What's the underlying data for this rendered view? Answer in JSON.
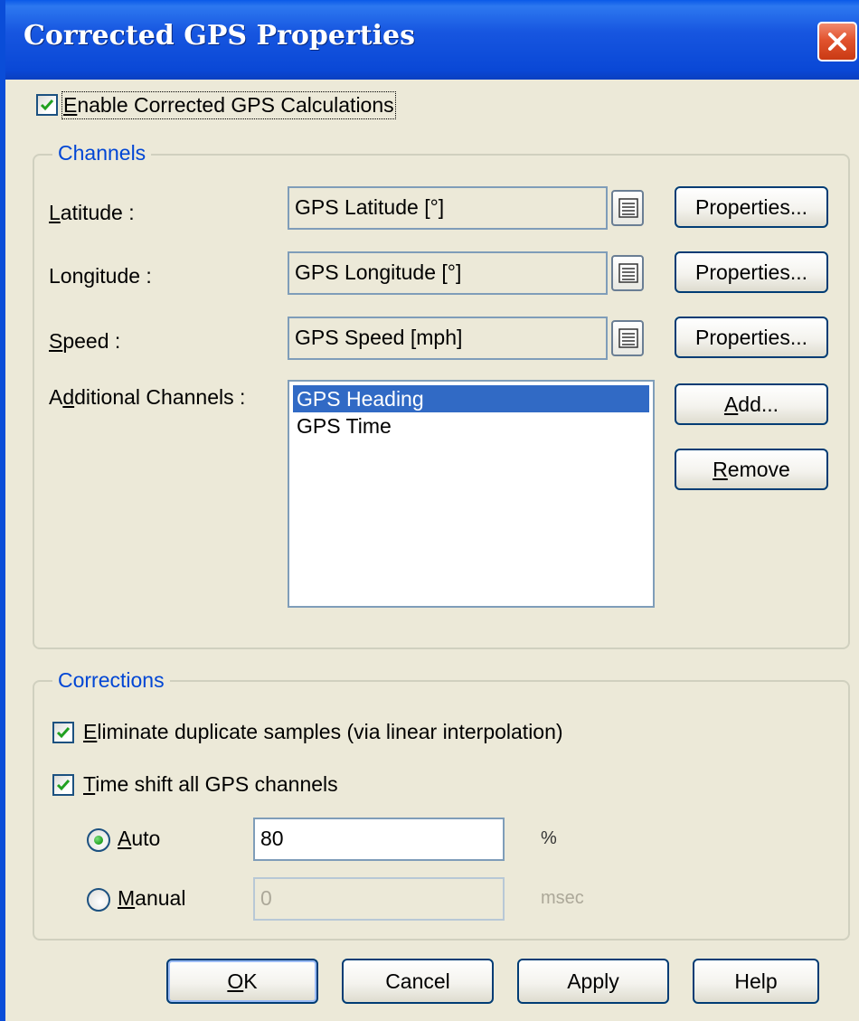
{
  "window": {
    "title": "Corrected GPS Properties"
  },
  "enable_checkbox": {
    "label_u": "E",
    "label_rest": "nable Corrected GPS Calculations",
    "checked": true
  },
  "channels": {
    "group_title": "Channels",
    "latitude": {
      "label_u": "L",
      "label_rest": "atitude :",
      "value": "GPS Latitude [°]",
      "properties_label": "Properties..."
    },
    "longitude": {
      "label_pre": "Lon",
      "label_u": "g",
      "label_rest": "itude :",
      "value": "GPS Longitude [°]",
      "properties_label": "Properties..."
    },
    "speed": {
      "label_u": "S",
      "label_rest": "peed :",
      "value": "GPS Speed [mph]",
      "properties_label": "Properties..."
    },
    "additional": {
      "label_pre": "A",
      "label_u": "d",
      "label_rest": "ditional Channels :",
      "items": [
        {
          "label": "GPS Heading",
          "selected": true
        },
        {
          "label": "GPS Time",
          "selected": false
        }
      ],
      "add_u": "A",
      "add_rest": "dd...",
      "remove_u": "R",
      "remove_rest": "emove"
    }
  },
  "corrections": {
    "group_title": "Corrections",
    "eliminate": {
      "label_u": "E",
      "label_rest": "liminate duplicate samples (via linear interpolation)",
      "checked": true
    },
    "time_shift": {
      "label_u": "T",
      "label_rest": "ime shift all GPS channels",
      "checked": true
    },
    "auto": {
      "label_u": "A",
      "label_rest": "uto",
      "value": "80",
      "unit": "%",
      "selected": true
    },
    "manual": {
      "label_u": "M",
      "label_rest": "anual",
      "value": "0",
      "unit": "msec",
      "selected": false
    }
  },
  "footer": {
    "ok_u": "O",
    "ok_rest": "K",
    "cancel": "Cancel",
    "apply": "Apply",
    "help": "Help"
  },
  "colors": {
    "title_bar": "#0A4DD8",
    "group_title": "#0046D5",
    "selection": "#316AC5",
    "close_button": "#E2532E",
    "dialog_bg": "#ECE9D8"
  }
}
